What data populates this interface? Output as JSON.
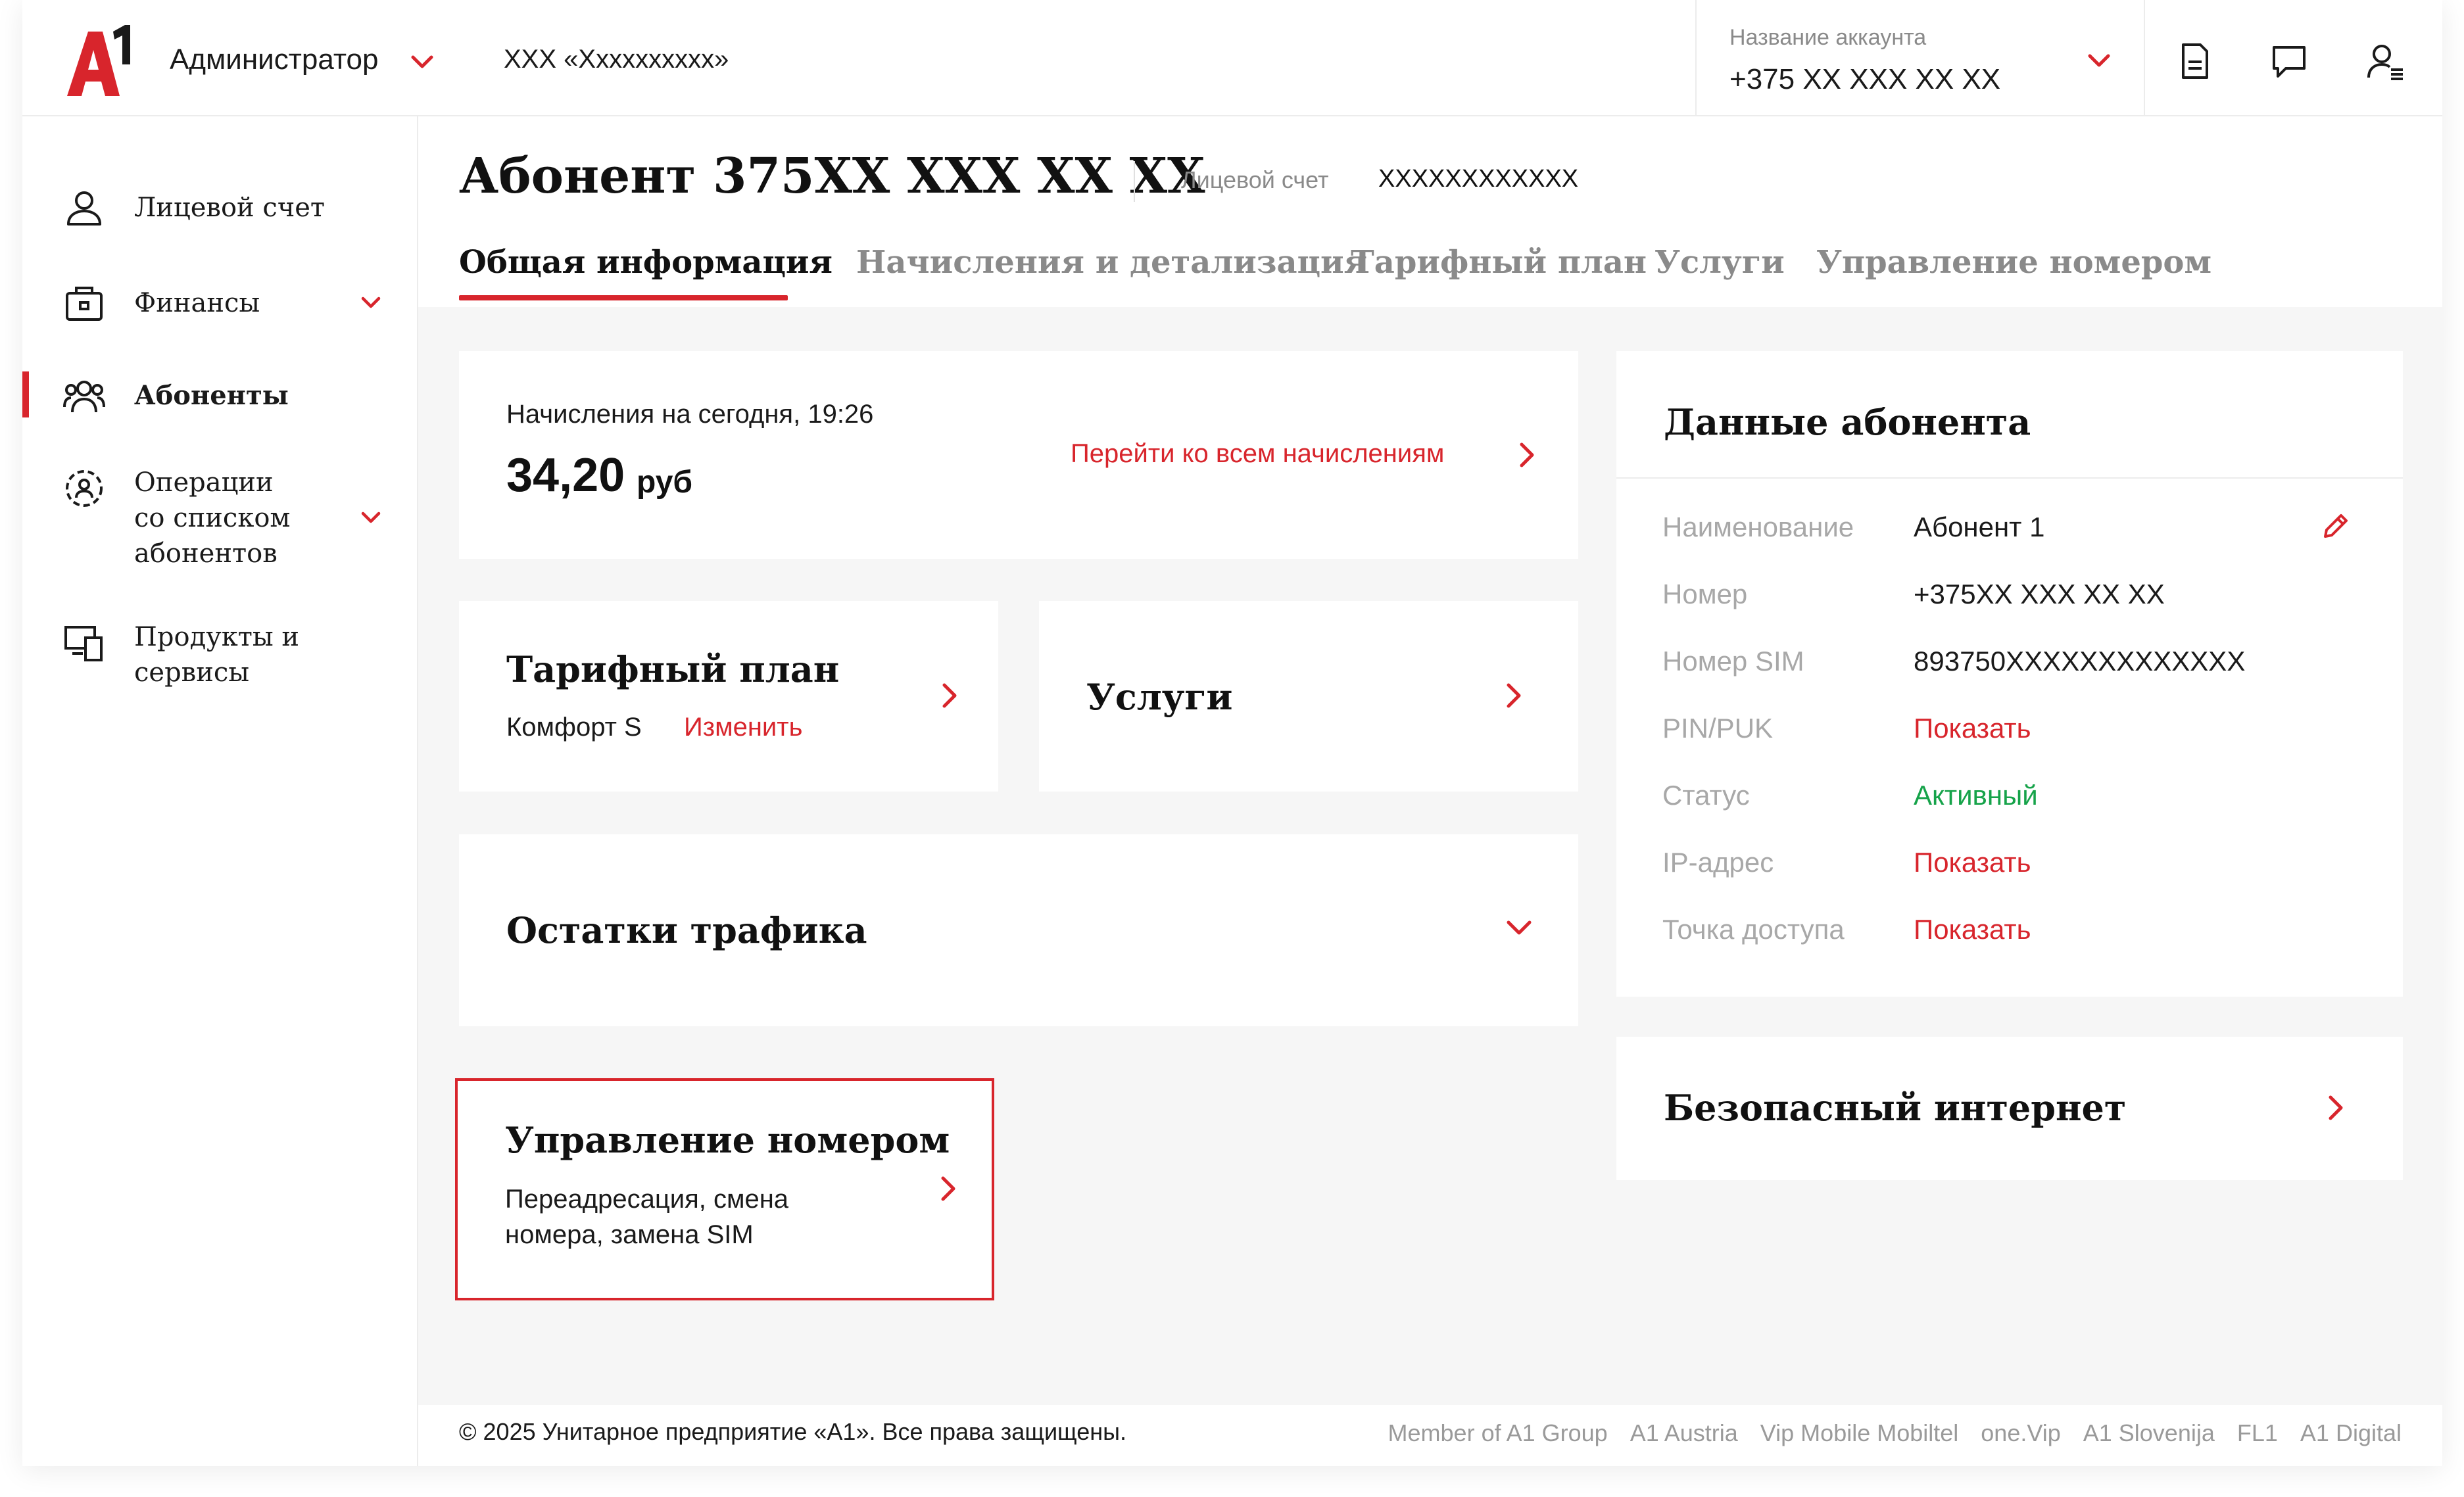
{
  "header": {
    "role": "Администратор",
    "company": "ХХХ «Хххххххххх»",
    "account_label": "Название аккаунта",
    "account_phone": "+375 XX XXX XX XX"
  },
  "sidebar": {
    "items": [
      {
        "label": "Лицевой счет",
        "icon": "person-icon"
      },
      {
        "label": "Финансы",
        "icon": "wallet-icon"
      },
      {
        "label": "Абоненты",
        "icon": "users-icon",
        "active": true
      },
      {
        "label": "Операции со списком абонентов",
        "icon": "users-circle-icon"
      },
      {
        "label": "Продукты и сервисы",
        "icon": "devices-icon"
      }
    ]
  },
  "page": {
    "title": "Абонент 375XX XXX XX XX",
    "ls_label": "Лицевой счет",
    "ls_value": "XXXXXXXXXXXX"
  },
  "tabs": [
    "Общая информация",
    "Начисления и детализация",
    "Тарифный план",
    "Услуги",
    "Управление номером"
  ],
  "charges": {
    "label": "Начисления на сегодня, 19:26",
    "amount": "34,20",
    "currency": "руб",
    "link": "Перейти ко всем начислениям"
  },
  "tariff": {
    "title": "Тарифный план",
    "name": "Комфорт S",
    "change": "Изменить"
  },
  "services": {
    "title": "Услуги"
  },
  "traffic": {
    "title": "Остатки трафика"
  },
  "number_mgmt": {
    "title": "Управление номером",
    "desc_line1": "Переадресация, смена",
    "desc_line2": "номера, замена SIM"
  },
  "subscriber": {
    "title": "Данные абонента",
    "rows": [
      {
        "label": "Наименование",
        "value": "Абонент 1"
      },
      {
        "label": "Номер",
        "value": "+375XX XXX XX XX"
      },
      {
        "label": "Номер SIM",
        "value": "893750XXXXXXXXXXXXX"
      },
      {
        "label": "PIN/PUK",
        "value": "Показать"
      },
      {
        "label": "Статус",
        "value": "Активный"
      },
      {
        "label": "IP-адрес",
        "value": "Показать"
      },
      {
        "label": "Точка доступа",
        "value": "Показать"
      }
    ]
  },
  "safe_internet": {
    "title": "Безопасный интернет"
  },
  "footer": {
    "copyright": "© 2025 Унитарное предприятие «А1». Все права защищены.",
    "links": [
      "Member of A1 Group",
      "A1 Austria",
      "Vip Mobile Mobiltel",
      "one.Vip",
      "A1 Slovenija",
      "FL1",
      "A1 Digital"
    ]
  },
  "colors": {
    "accent": "#d8252c",
    "status_active": "#16a34a",
    "background": "#f6f6f6"
  }
}
